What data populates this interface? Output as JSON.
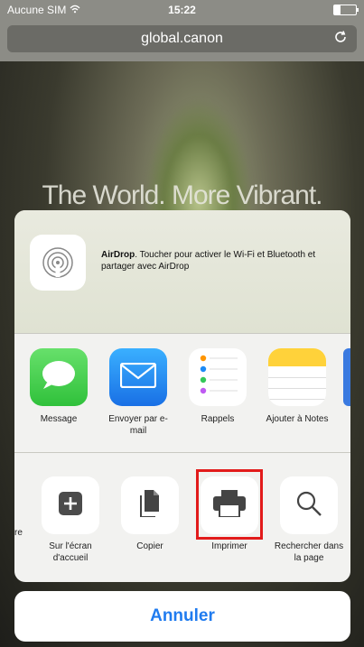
{
  "status": {
    "carrier": "Aucune SIM",
    "time": "15:22",
    "battery_level": 0.3
  },
  "browser": {
    "url": "global.canon",
    "hero_text": "The World. More Vibrant."
  },
  "share_sheet": {
    "airdrop": {
      "title": "AirDrop",
      "description": ". Toucher pour activer le Wi-Fi et Bluetooth et partager avec AirDrop"
    },
    "apps": [
      {
        "label": "Message",
        "icon": "message-icon"
      },
      {
        "label": "Envoyer par e-mail",
        "icon": "mail-icon"
      },
      {
        "label": "Rappels",
        "icon": "reminders-icon"
      },
      {
        "label": "Ajouter à Notes",
        "icon": "notes-icon"
      }
    ],
    "actions": [
      {
        "label": "Sur l'écran d'accueil",
        "icon": "add-to-home-icon"
      },
      {
        "label": "Copier",
        "icon": "copy-icon"
      },
      {
        "label": "Imprimer",
        "icon": "printer-icon"
      },
      {
        "label": "Rechercher dans la page",
        "icon": "search-icon"
      }
    ],
    "left_partial_label": "re",
    "cancel_label": "Annuler"
  },
  "colors": {
    "accent": "#1f7bef",
    "highlight": "#e21b1b"
  }
}
